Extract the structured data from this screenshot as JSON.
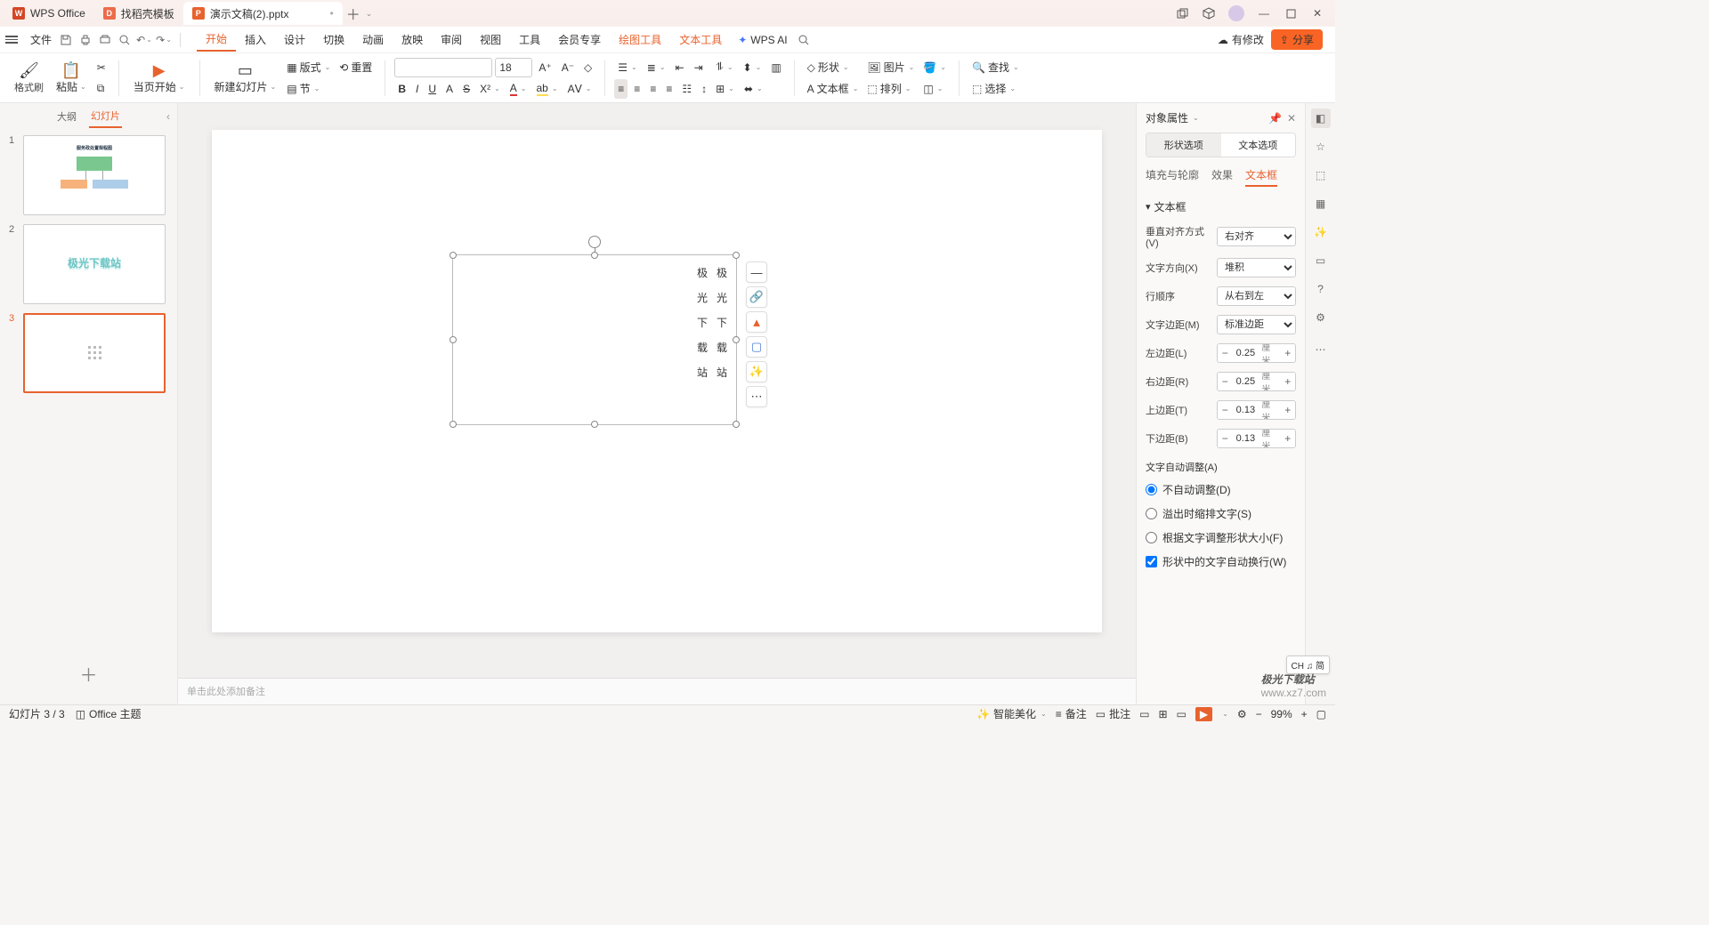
{
  "titlebar": {
    "tabs": [
      {
        "label": "WPS Office",
        "icon": "W"
      },
      {
        "label": "找稻壳模板",
        "icon": "D"
      },
      {
        "label": "演示文稿(2).pptx",
        "icon": "P",
        "active": true,
        "dirty": "•"
      }
    ]
  },
  "menubar": {
    "file": "文件",
    "tabs": [
      "开始",
      "插入",
      "设计",
      "切换",
      "动画",
      "放映",
      "审阅",
      "视图",
      "工具",
      "会员专享"
    ],
    "extra": [
      "绘图工具",
      "文本工具"
    ],
    "wpsai": "WPS AI",
    "pending": "有修改",
    "share": "分享"
  },
  "ribbon": {
    "format_painter": "格式刷",
    "paste": "粘贴",
    "from_current": "当页开始",
    "new_slide": "新建幻灯片",
    "layout": "版式",
    "reset": "重置",
    "section": "节",
    "font_size": "18",
    "shape": "形状",
    "picture": "图片",
    "textbox": "文本框",
    "arrange": "排列",
    "find": "查找",
    "select": "选择"
  },
  "thumbs": {
    "outline": "大纲",
    "slides": "幻灯片",
    "slide2_text": "极光下载站"
  },
  "canvas": {
    "text1": "极光下载站",
    "text2": "极光下载站",
    "notes_placeholder": "单击此处添加备注"
  },
  "panel": {
    "title": "对象属性",
    "seg_shape": "形状选项",
    "seg_text": "文本选项",
    "sub_fill": "填充与轮廓",
    "sub_effect": "效果",
    "sub_textbox": "文本框",
    "sec_textbox": "文本框",
    "valign_label": "垂直对齐方式(V)",
    "valign_val": "右对齐",
    "dir_label": "文字方向(X)",
    "dir_val": "堆积",
    "order_label": "行顺序",
    "order_val": "从右到左",
    "margin_label": "文字边距(M)",
    "margin_val": "标准边距",
    "left_label": "左边距(L)",
    "left_val": "0.25",
    "unit": "厘米",
    "right_label": "右边距(R)",
    "right_val": "0.25",
    "top_label": "上边距(T)",
    "top_val": "0.13",
    "bottom_label": "下边距(B)",
    "bottom_val": "0.13",
    "autofit_label": "文字自动调整(A)",
    "r1": "不自动调整(D)",
    "r2": "溢出时缩排文字(S)",
    "r3": "根据文字调整形状大小(F)",
    "wrap": "形状中的文字自动换行(W)"
  },
  "status": {
    "slide_info": "幻灯片 3 / 3",
    "theme": "Office 主题",
    "beautify": "智能美化",
    "notes": "备注",
    "comments": "批注",
    "zoom": "99%"
  },
  "ime": "CH ♫ 简",
  "watermark": {
    "l1": "极光下载站",
    "l2": "www.xz7.com"
  }
}
